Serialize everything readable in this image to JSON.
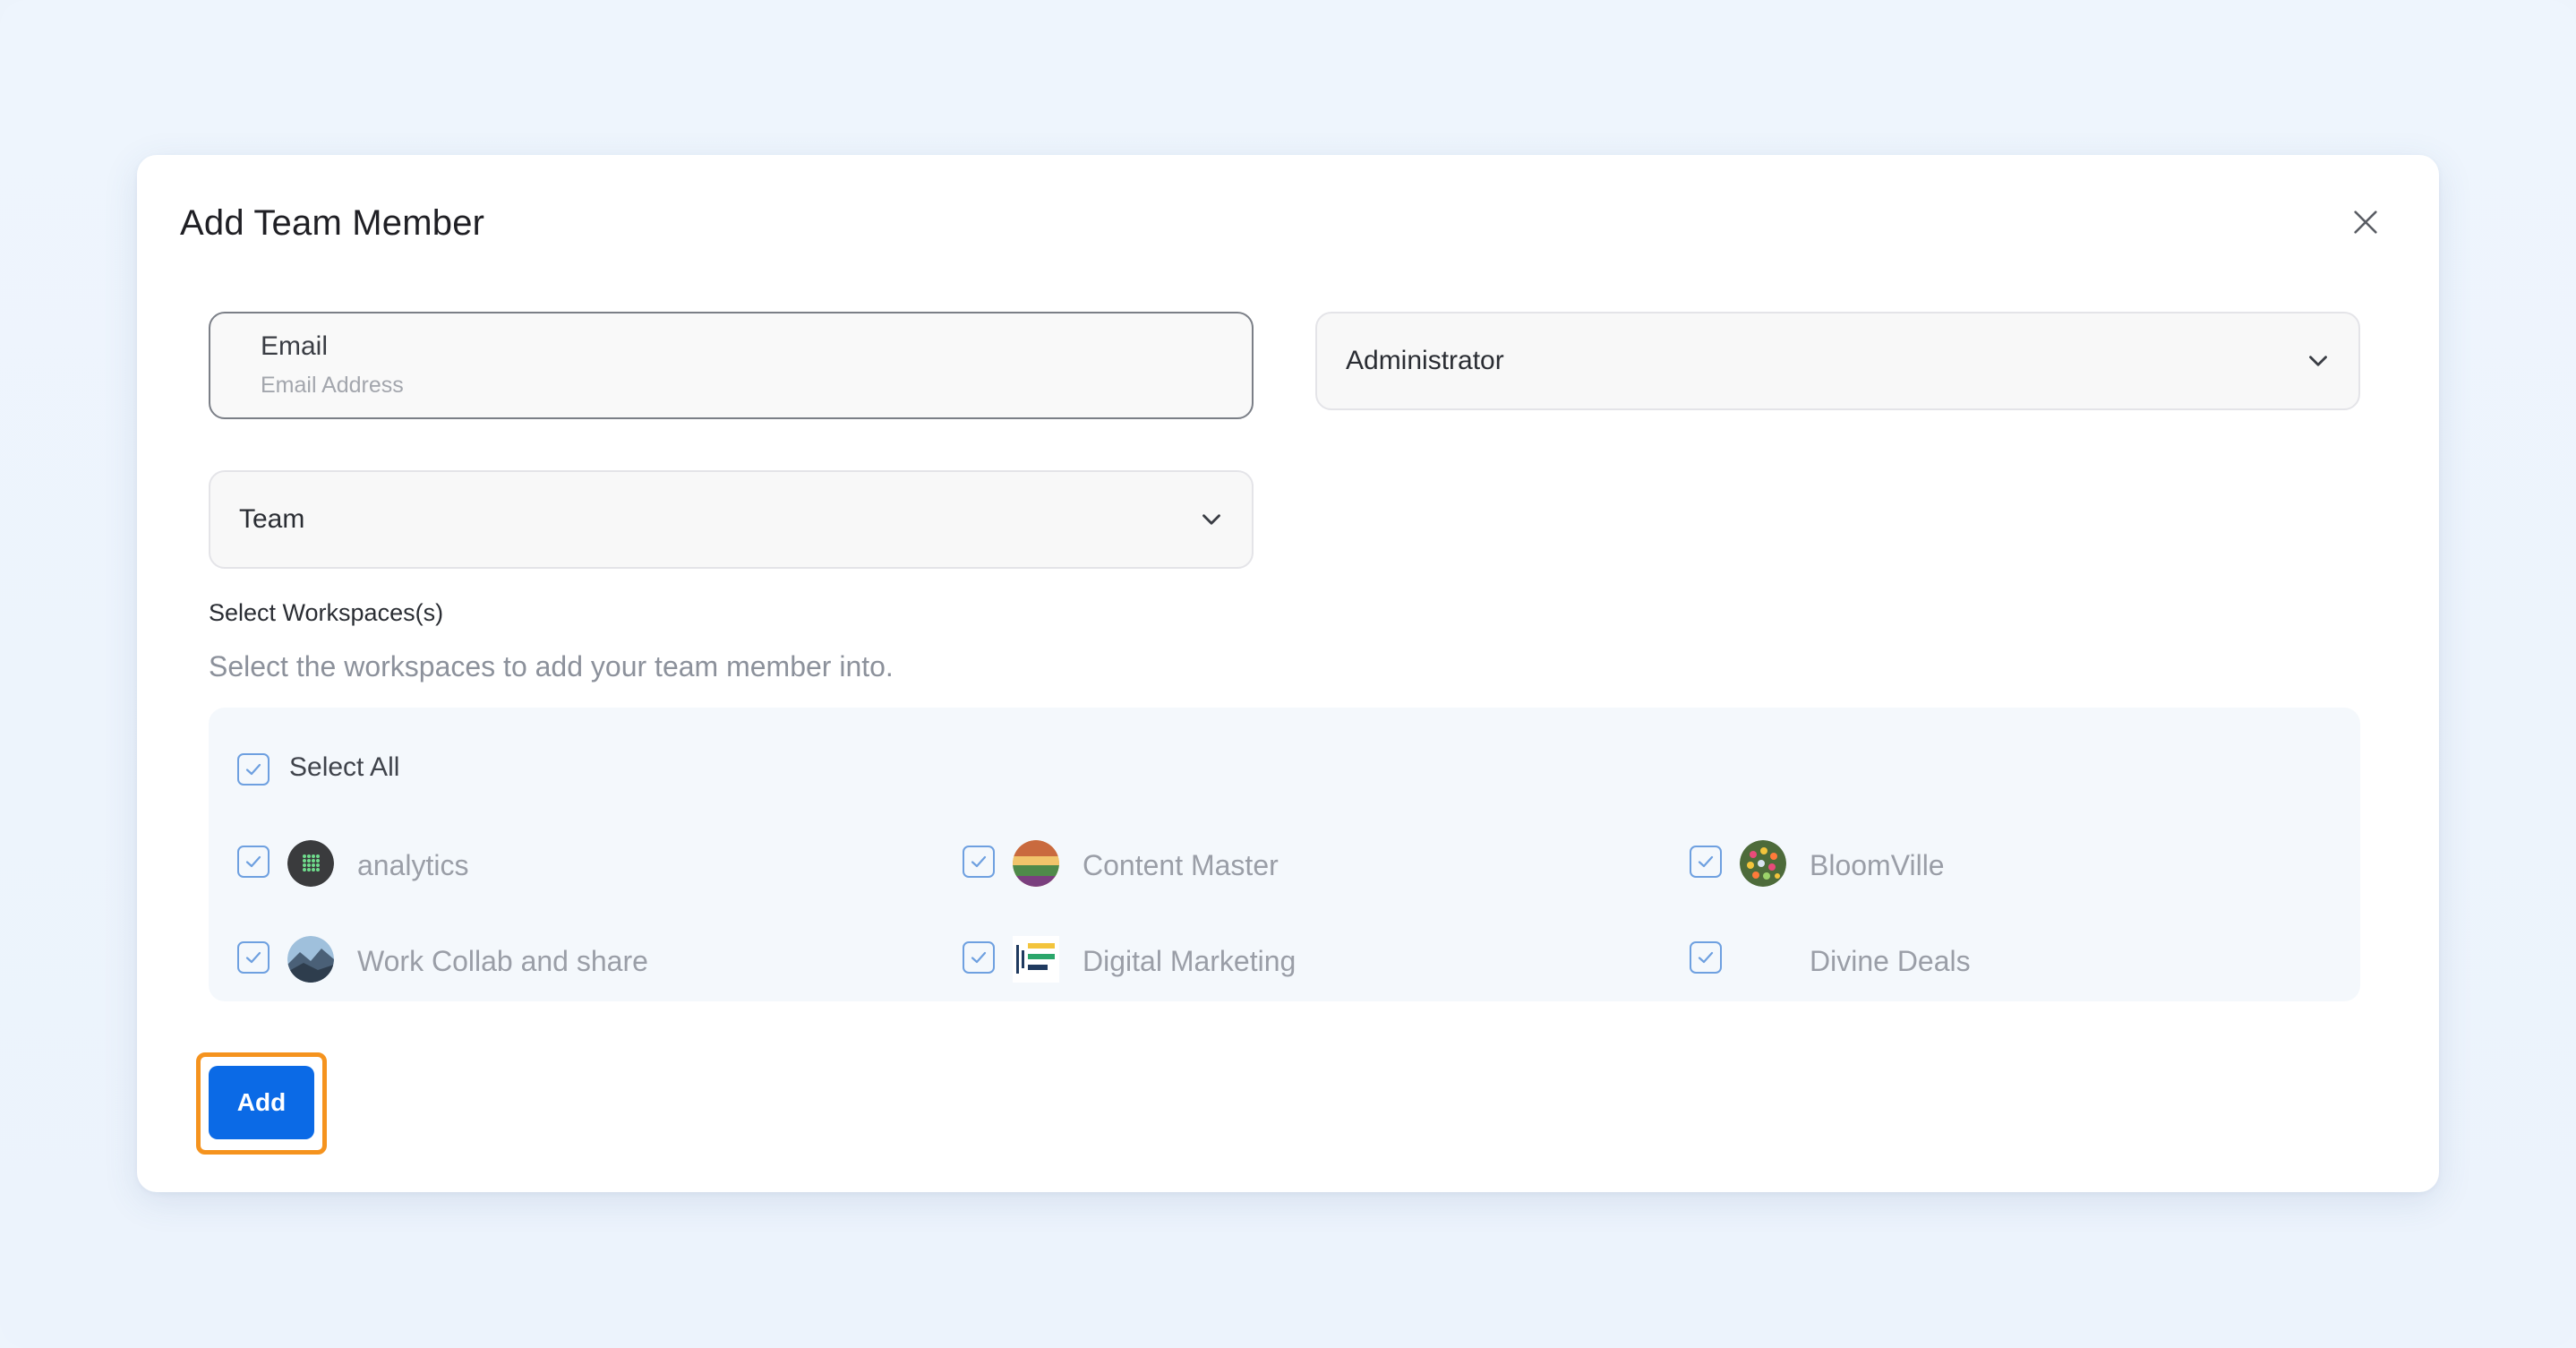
{
  "modal": {
    "title": "Add Team Member"
  },
  "form": {
    "email": {
      "label": "Email",
      "placeholder": "Email Address",
      "value": ""
    },
    "role": {
      "selected": "Administrator"
    },
    "team": {
      "selected": "Team"
    }
  },
  "workspaces": {
    "label": "Select Workspaces(s)",
    "description": "Select the workspaces to add your team member into.",
    "select_all_label": "Select All",
    "select_all_checked": true,
    "items": [
      {
        "name": "analytics",
        "checked": true,
        "icon": "analytics-avatar-icon"
      },
      {
        "name": "Content Master",
        "checked": true,
        "icon": "content-master-avatar-icon"
      },
      {
        "name": "BloomVille",
        "checked": true,
        "icon": "bloomville-avatar-icon"
      },
      {
        "name": "Work Collab and share",
        "checked": true,
        "icon": "work-collab-avatar-icon"
      },
      {
        "name": "Digital Marketing",
        "checked": true,
        "icon": "digital-marketing-avatar-icon"
      },
      {
        "name": "Divine Deals",
        "checked": true,
        "icon": ""
      }
    ]
  },
  "actions": {
    "add_label": "Add"
  },
  "colors": {
    "primary": "#0b6ae6",
    "highlight": "#f5931e",
    "checkbox": "#6ea0e0"
  }
}
